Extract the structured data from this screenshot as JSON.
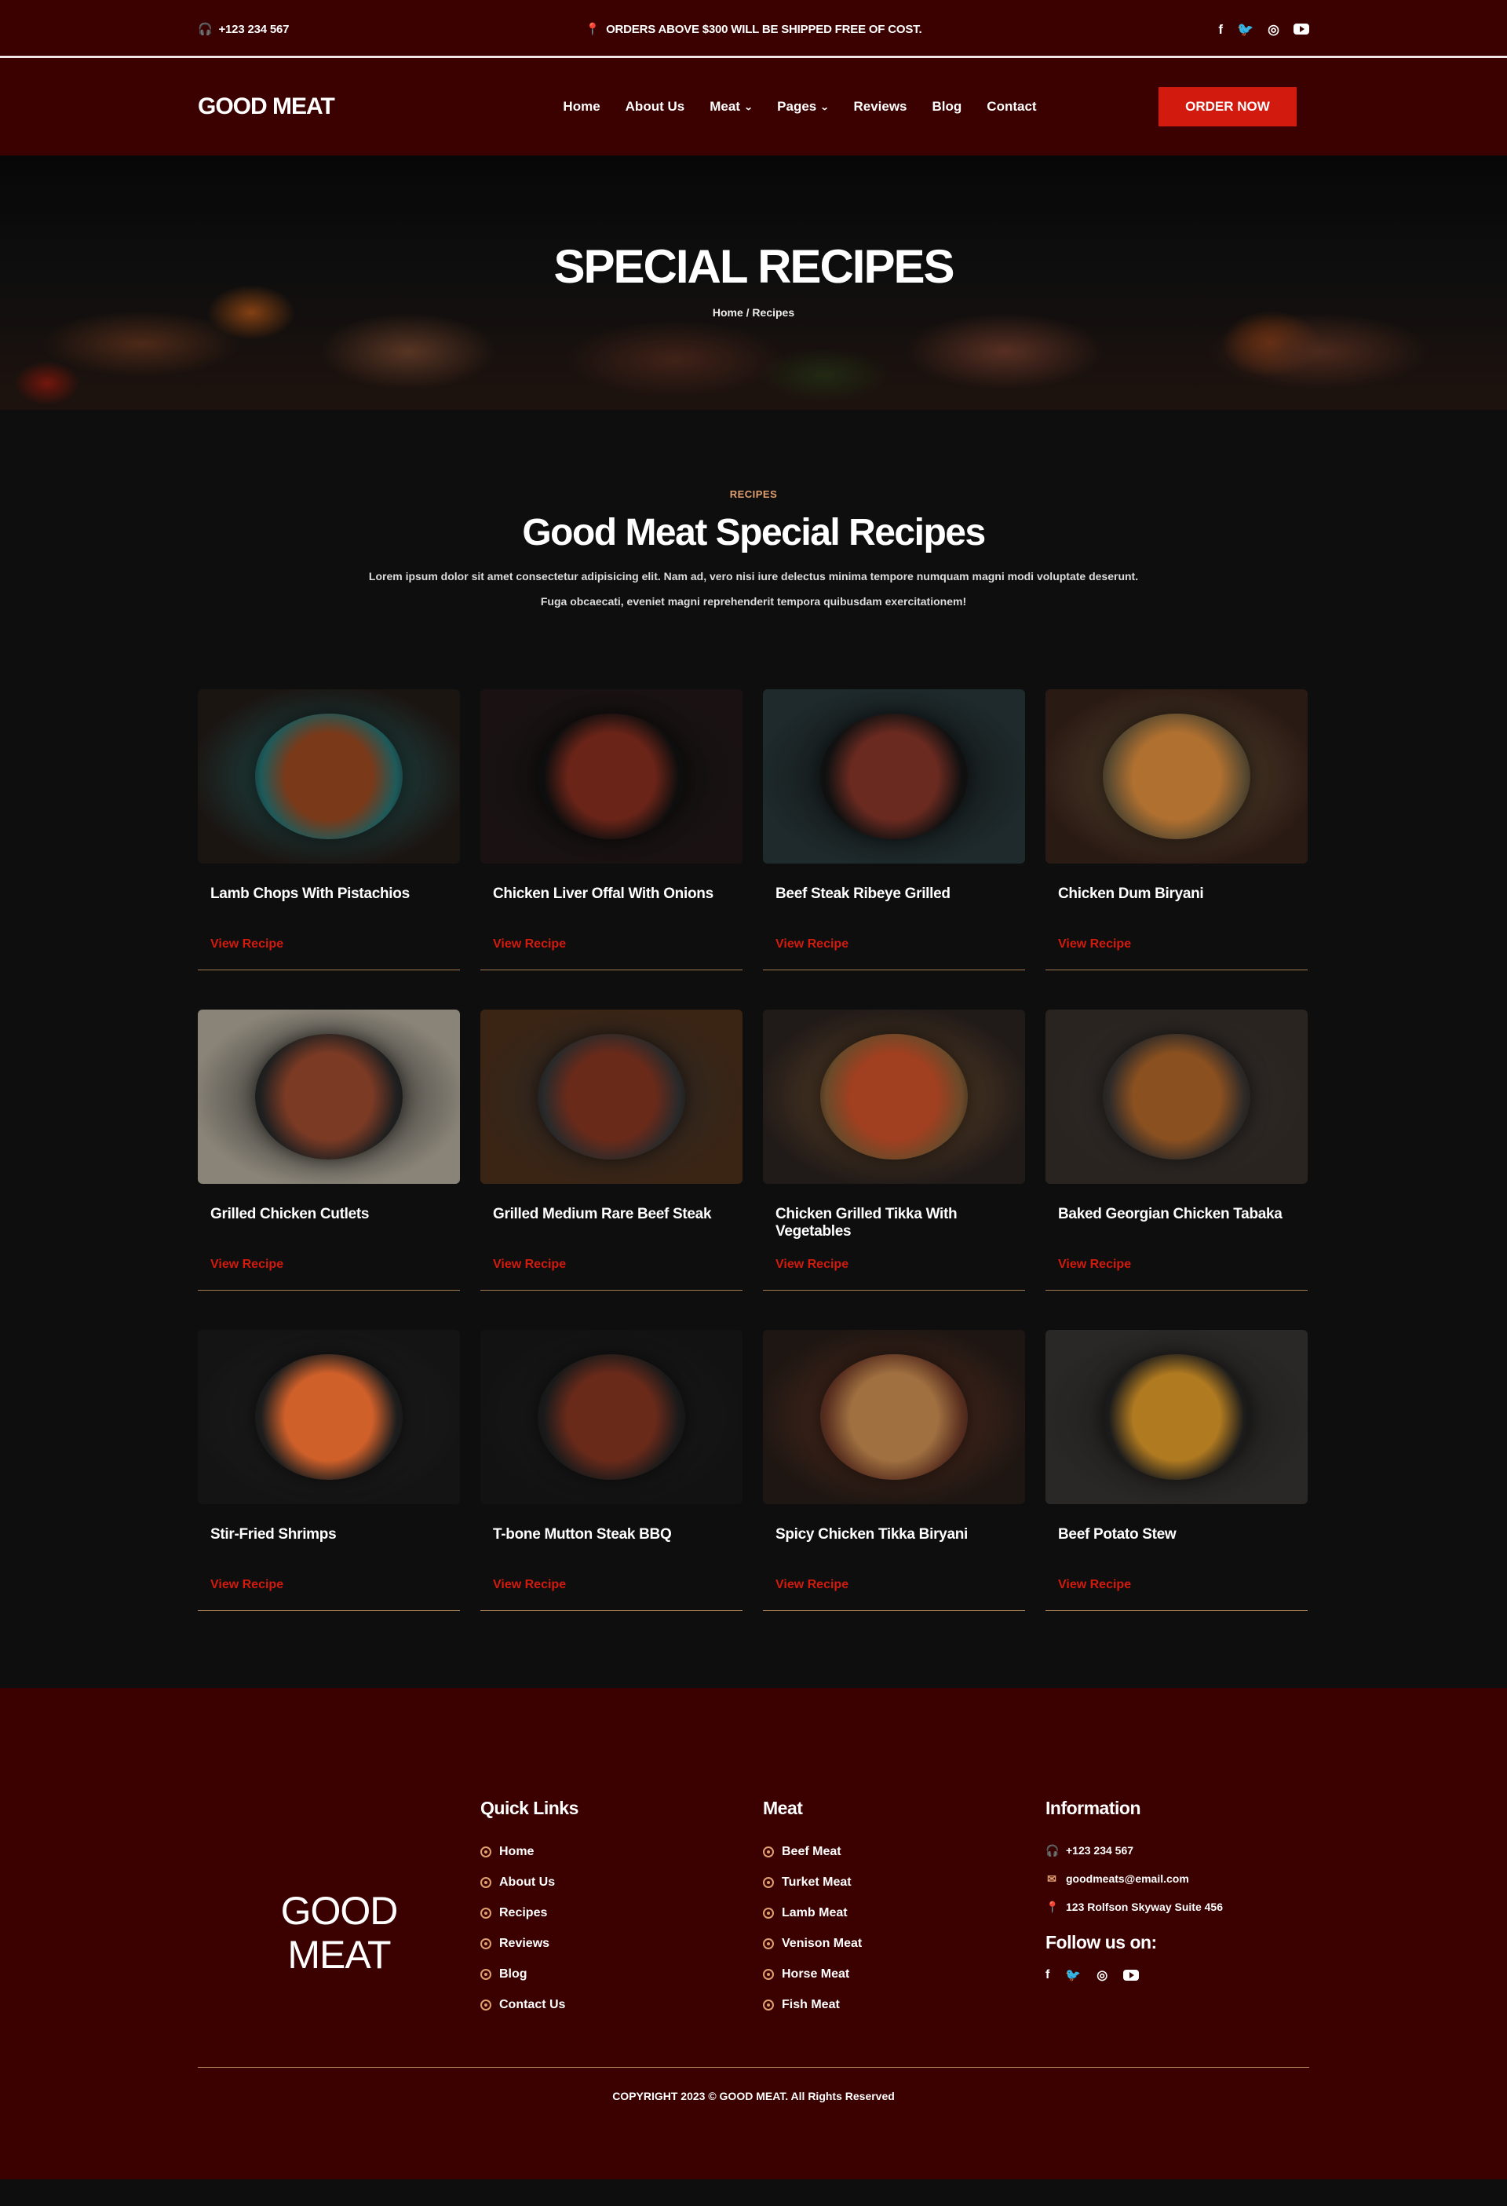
{
  "topbar": {
    "phone": "+123 234 567",
    "shipping_notice": "ORDERS ABOVE $300 WILL BE SHIPPED FREE OF COST.",
    "social": [
      "f",
      "t",
      "ig",
      "yt"
    ]
  },
  "nav": {
    "logo": "GOOD MEAT",
    "items": [
      {
        "label": "Home"
      },
      {
        "label": "About Us"
      },
      {
        "label": "Meat",
        "dropdown": true
      },
      {
        "label": "Pages",
        "dropdown": true
      },
      {
        "label": "Reviews"
      },
      {
        "label": "Blog"
      },
      {
        "label": "Contact"
      }
    ],
    "cta": "ORDER NOW"
  },
  "hero": {
    "title": "SPECIAL RECIPES",
    "breadcrumb": "Home / Recipes"
  },
  "intro": {
    "eyebrow": "RECIPES",
    "title": "Good Meat Special Recipes",
    "desc_line1": "Lorem ipsum dolor sit amet consectetur adipisicing elit. Nam ad, vero nisi iure delectus minima tempore numquam magni modi voluptate deserunt.",
    "desc_line2": "Fuga obcaecati, eveniet magni reprehenderit tempora quibusdam exercitationem!"
  },
  "recipes": [
    {
      "name": "Lamb Chops With Pistachios",
      "link": "View Recipe",
      "bg": "#1b1512",
      "accent": "#1e5a5a",
      "food": "#7a3a1a"
    },
    {
      "name": "Chicken Liver Offal With Onions",
      "link": "View Recipe",
      "bg": "#1a1212",
      "accent": "#0e0e0e",
      "food": "#6a2418"
    },
    {
      "name": "Beef Steak Ribeye Grilled",
      "link": "View Recipe",
      "bg": "#1e2a2c",
      "accent": "#111",
      "food": "#6a2a20"
    },
    {
      "name": "Chicken Dum Biryani",
      "link": "View Recipe",
      "bg": "#2a1a14",
      "accent": "#5a4a30",
      "food": "#b07030"
    },
    {
      "name": "Grilled Chicken Cutlets",
      "link": "View Recipe",
      "bg": "#8a8478",
      "accent": "#202020",
      "food": "#7a3a24"
    },
    {
      "name": "Grilled Medium Rare Beef Steak",
      "link": "View Recipe",
      "bg": "#3a2414",
      "accent": "#2a2a2a",
      "food": "#6a2a1a"
    },
    {
      "name": "Chicken Grilled Tikka With Vegetables",
      "link": "View Recipe",
      "bg": "#201a18",
      "accent": "#6a4a2a",
      "food": "#a04020"
    },
    {
      "name": "Baked Georgian Chicken Tabaka",
      "link": "View Recipe",
      "bg": "#2a2420",
      "accent": "#2e2a28",
      "food": "#8a5020"
    },
    {
      "name": "Stir-Fried Shrimps",
      "link": "View Recipe",
      "bg": "#141414",
      "accent": "#1e1e1e",
      "food": "#d0602a"
    },
    {
      "name": "T-bone Mutton Steak BBQ",
      "link": "View Recipe",
      "bg": "#121212",
      "accent": "#1a1a1a",
      "food": "#6a2a1a"
    },
    {
      "name": "Spicy Chicken Tikka Biryani",
      "link": "View Recipe",
      "bg": "#1e1612",
      "accent": "#5a3020",
      "food": "#a07040"
    },
    {
      "name": "Beef Potato Stew",
      "link": "View Recipe",
      "bg": "#2a2826",
      "accent": "#1c1c1c",
      "food": "#b07a20"
    }
  ],
  "footer": {
    "logo_line1": "GOOD",
    "logo_line2": "MEAT",
    "quick_links": {
      "title": "Quick Links",
      "items": [
        "Home",
        "About Us",
        "Recipes",
        "Reviews",
        "Blog",
        "Contact Us"
      ]
    },
    "meat": {
      "title": "Meat",
      "items": [
        "Beef Meat",
        "Turket Meat",
        "Lamb Meat",
        "Venison Meat",
        "Horse Meat",
        "Fish Meat"
      ]
    },
    "information": {
      "title": "Information",
      "phone": "+123 234 567",
      "email": "goodmeats@email.com",
      "address": "123 Rolfson Skyway Suite 456"
    },
    "follow_title": "Follow us on:",
    "copyright": "COPYRIGHT 2023 © GOOD MEAT. All Rights Reserved"
  },
  "colors": {
    "brand_dark": "#3b0000",
    "accent_red": "#d21a0f",
    "accent_gold": "#e0a070",
    "page_bg": "#0e0e0e"
  }
}
